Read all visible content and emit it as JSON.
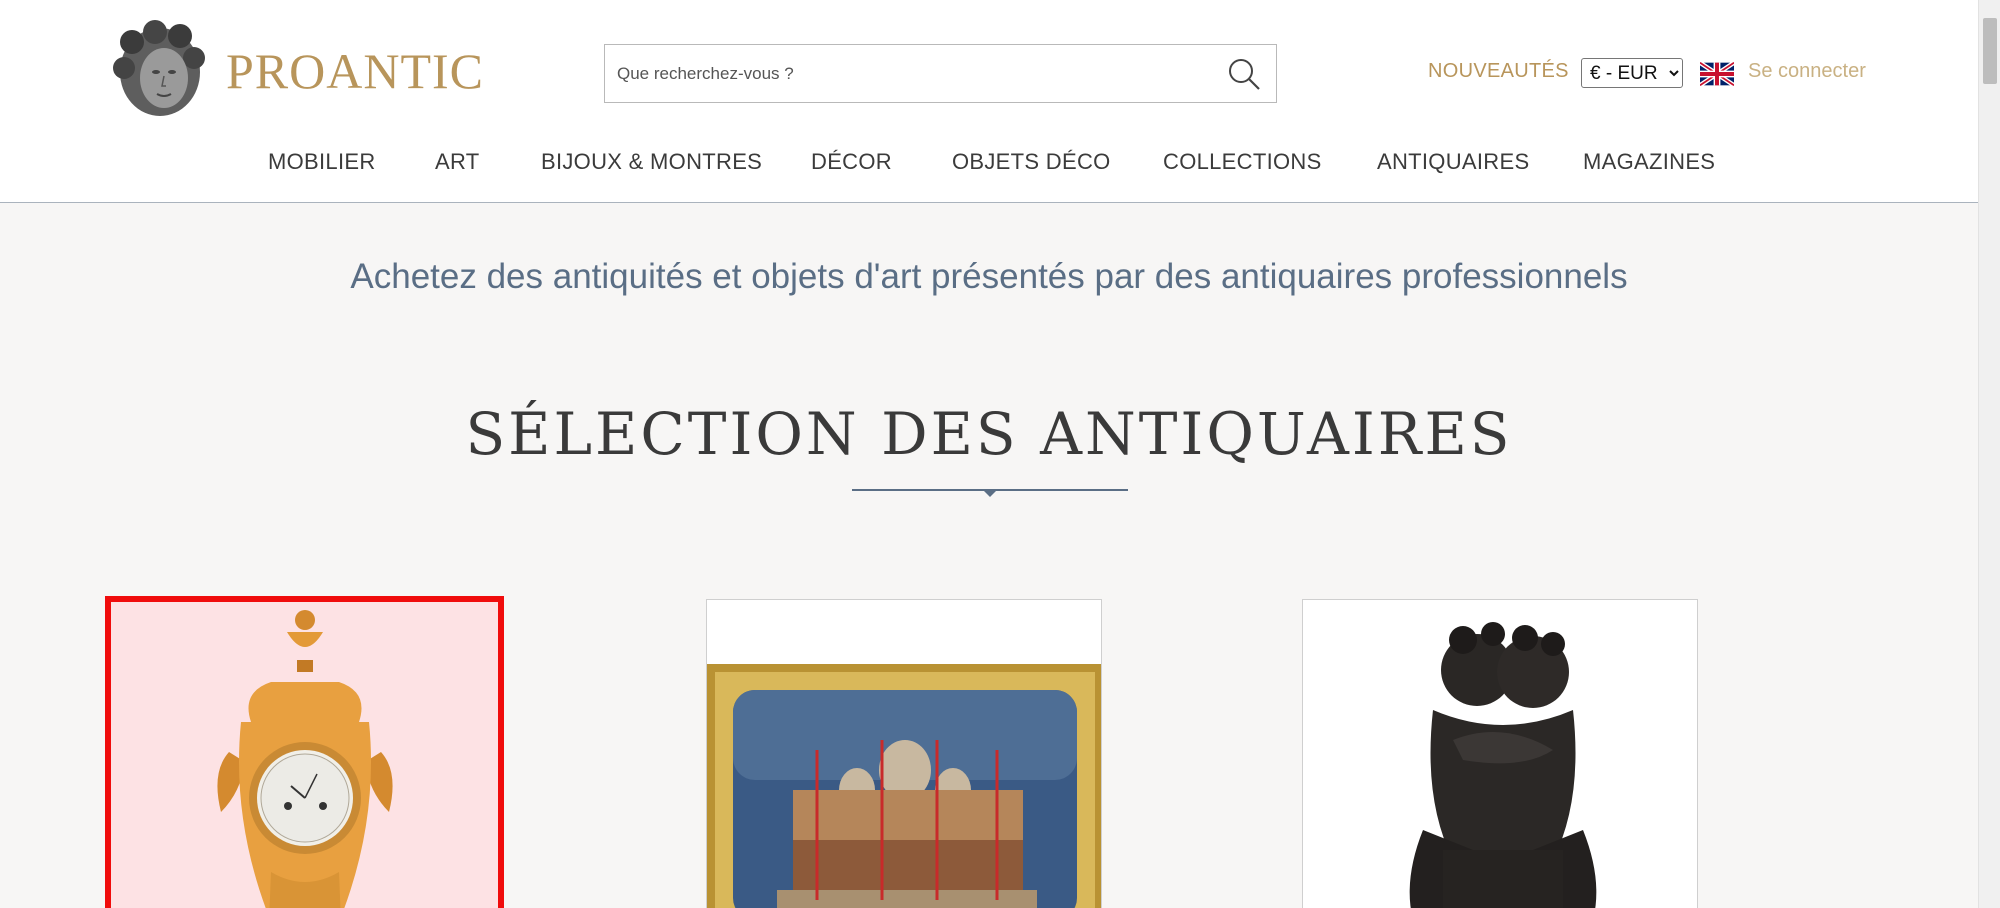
{
  "brand": {
    "name": "PROANTIC",
    "logo_icon": "cherub-head-logo"
  },
  "search": {
    "placeholder": "Que recherchez-vous ?",
    "icon": "search-icon"
  },
  "header_links": {
    "nouveautes": "NOUVEAUTÉS",
    "currency": "€ - EUR",
    "currency_options": [
      "€ - EUR"
    ],
    "language_icon": "uk-flag-icon",
    "login": "Se connecter"
  },
  "nav": {
    "items": [
      "MOBILIER",
      "ART",
      "BIJOUX & MONTRES",
      "DÉCOR",
      "OBJETS DÉCO",
      "COLLECTIONS",
      "ANTIQUAIRES",
      "MAGAZINES"
    ]
  },
  "tagline": "Achetez des antiquités et objets d'art présentés par des antiquaires professionnels",
  "section": {
    "title": "SÉLECTION DES ANTIQUAIRES"
  },
  "cards": [
    {
      "image": "gilt-bronze-mantel-clock",
      "selected": true
    },
    {
      "image": "venice-st-marks-painting-gilt-frame",
      "selected": false
    },
    {
      "image": "bronze-cherubs-sculpture",
      "selected": false
    }
  ],
  "colors": {
    "brand_gold": "#b8955b",
    "accent_blue": "#5a6e85",
    "selection_red": "#f00c0c"
  }
}
